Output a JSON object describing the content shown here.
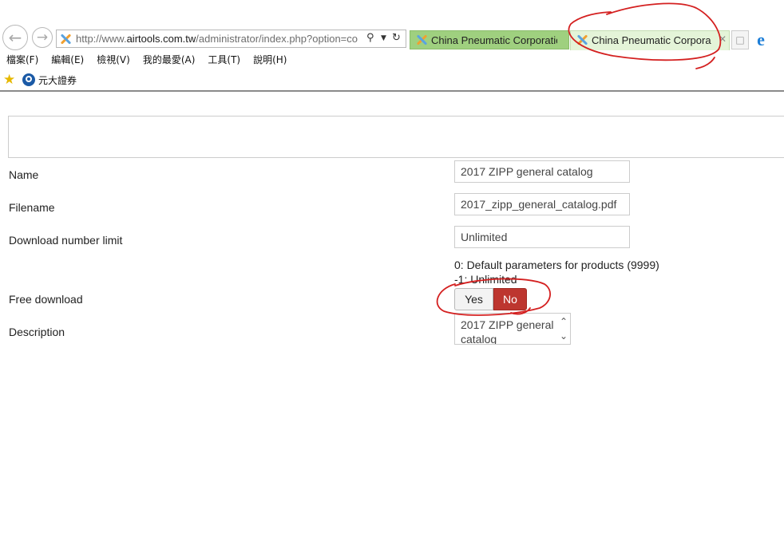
{
  "browser": {
    "url_prefix": "http://www.",
    "url_host": "airtools.com.tw",
    "url_path": "/administrator/index.php?option=co",
    "tabs": [
      {
        "label": "China Pneumatic Corporatio..."
      },
      {
        "label": "China Pneumatic Corpora..."
      }
    ],
    "menu": [
      "檔案(F)",
      "編輯(E)",
      "檢視(V)",
      "我的最愛(A)",
      "工具(T)",
      "說明(H)"
    ],
    "favorites": [
      {
        "label": "元大證券"
      }
    ]
  },
  "form": {
    "name_label": "Name",
    "name_value": "2017 ZIPP general catalog",
    "filename_label": "Filename",
    "filename_value": "2017_zipp_general_catalog.pdf",
    "limit_label": "Download number limit",
    "limit_value": "Unlimited",
    "limit_hint_1": "0: Default parameters for products (9999)",
    "limit_hint_2": "-1: Unlimited",
    "free_label": "Free download",
    "free_yes": "Yes",
    "free_no": "No",
    "free_selected": "No",
    "desc_label": "Description",
    "desc_value": "2017 ZIPP general catalog"
  },
  "colors": {
    "active_toggle": "#bd362f",
    "annotation": "#d42020",
    "tab_inactive": "#9fd07f",
    "tab_active": "#e4f4d8"
  },
  "icons": [
    "back-icon",
    "forward-icon",
    "joomla-icon",
    "search-icon",
    "dropdown-icon",
    "refresh-icon",
    "close-icon",
    "new-tab-icon",
    "ie-icon",
    "star-icon",
    "yuanta-icon",
    "chevron-up-icon",
    "chevron-down-icon"
  ]
}
